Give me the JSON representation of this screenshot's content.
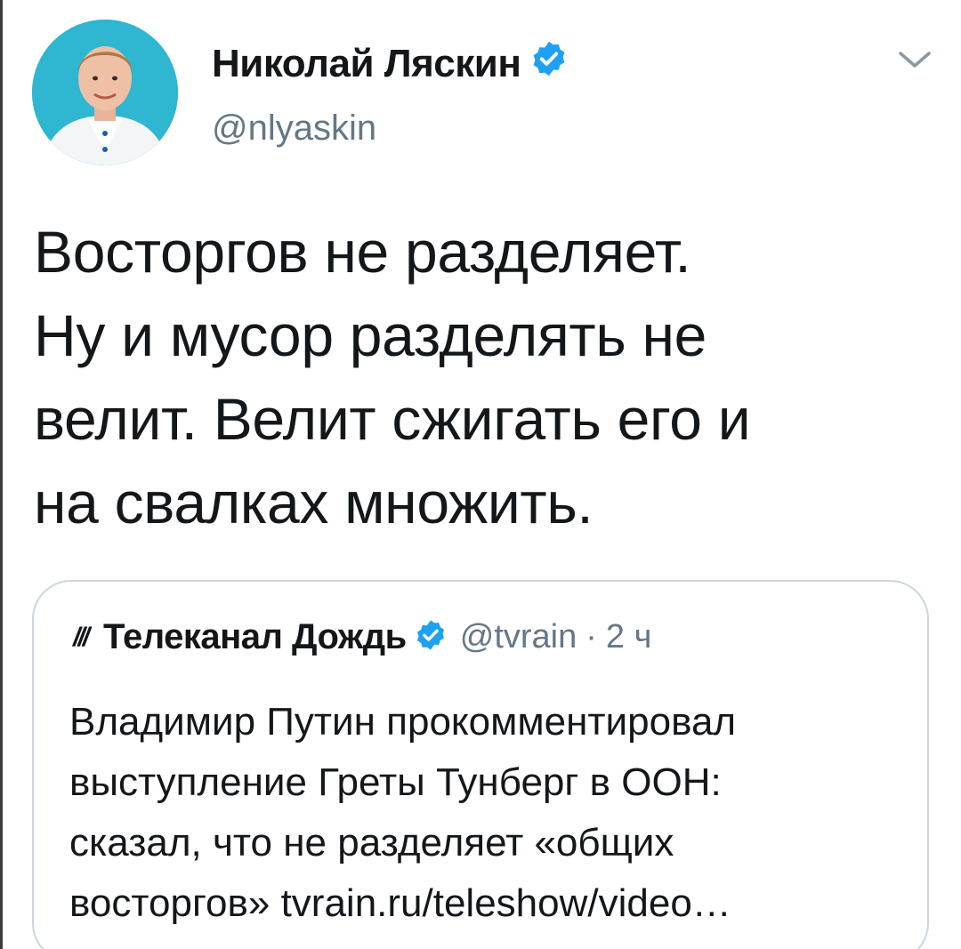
{
  "tweet": {
    "author": {
      "name": "Николай Ляскин",
      "handle": "@nlyaskin",
      "verified": true
    },
    "text_lines": [
      "Восторгов не разделяет.",
      "Ну и мусор разделять не",
      "велит. Велит сжигать его и",
      "на свалках множить."
    ]
  },
  "quoted_tweet": {
    "logo_text": "///",
    "author_name": "Телеканал Дождь",
    "verified": true,
    "handle": "@tvrain",
    "separator": "·",
    "time": "2 ч",
    "text_lines": [
      "Владимир Путин прокомментировал",
      "выступление Греты Тунберг в ООН:",
      "сказал, что не разделяет «общих",
      "восторгов» tvrain.ru/teleshow/video…"
    ]
  },
  "icons": {
    "verified": "verified-badge-icon",
    "caret": "chevron-down-icon",
    "avatar": "profile-photo"
  },
  "colors": {
    "verified_blue": "#1da1f2",
    "secondary_text": "#657786",
    "card_border": "#ccd6dd",
    "avatar_bg": "#2fb6d0"
  }
}
